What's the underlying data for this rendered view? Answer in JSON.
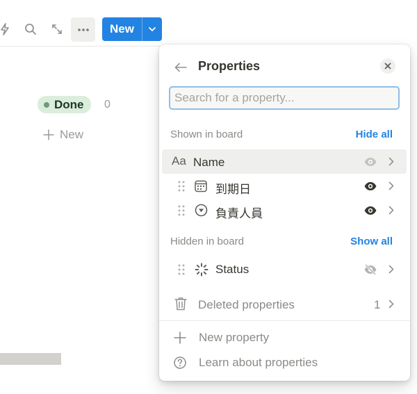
{
  "toolbar": {
    "icons": [
      "lightning-icon",
      "search-icon",
      "expand-icon",
      "more-icon"
    ],
    "new_button": "New",
    "accent": "#2383e2"
  },
  "board": {
    "group_label": "Done",
    "group_count": "0",
    "new_label": "New"
  },
  "properties_panel": {
    "title": "Properties",
    "search_placeholder": "Search for a property...",
    "shown_section": {
      "label": "Shown in board",
      "action": "Hide all"
    },
    "shown": [
      {
        "label": "Name",
        "type_icon": "text-aa-icon",
        "visible": true,
        "locked": true
      },
      {
        "label": "到期日",
        "type_icon": "calendar-icon",
        "visible": true
      },
      {
        "label": "負責人員",
        "type_icon": "select-icon",
        "visible": true
      }
    ],
    "hidden_section": {
      "label": "Hidden in board",
      "action": "Show all"
    },
    "hidden": [
      {
        "label": "Status",
        "type_icon": "status-icon",
        "visible": false
      }
    ],
    "deleted": {
      "label": "Deleted properties",
      "count": "1"
    },
    "footer": {
      "new_property": "New property",
      "learn": "Learn about properties"
    }
  }
}
